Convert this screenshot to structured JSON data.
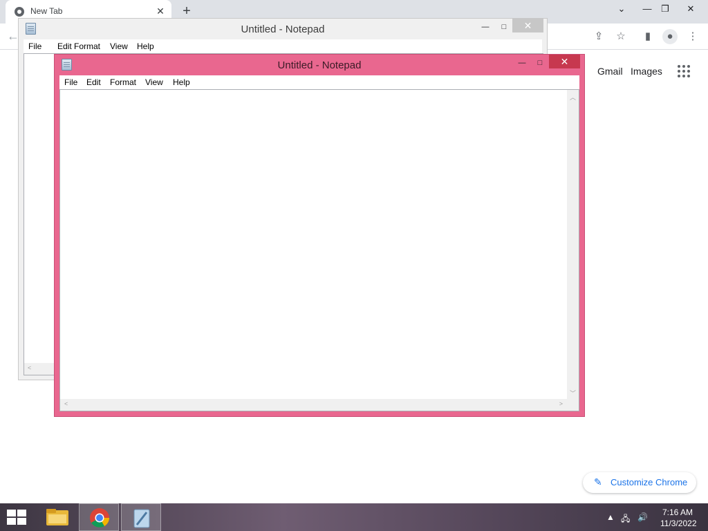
{
  "browser": {
    "tab_title": "New Tab",
    "tab_close": "✕",
    "new_tab": "+",
    "window_buttons": {
      "dropdown": "⌄",
      "minimize": "—",
      "restore": "❐",
      "close": "✕"
    },
    "toolbar_icons": {
      "share": "⇪",
      "bookmark": "☆",
      "side_panel": "▮",
      "profile": "●",
      "menu": "⋮"
    },
    "back": "←",
    "ntp": {
      "gmail": "Gmail",
      "images": "Images",
      "customize": "Customize Chrome",
      "customize_icon": "✎"
    }
  },
  "notepad_back": {
    "title": "Untitled - Notepad",
    "menu": [
      "File",
      "Edit",
      "Format",
      "View",
      "Help"
    ],
    "buttons": {
      "minimize": "—",
      "maximize": "□",
      "close": "✕"
    }
  },
  "notepad_front": {
    "title": "Untitled - Notepad",
    "menu": [
      "File",
      "Edit",
      "Format",
      "View",
      "Help"
    ],
    "buttons": {
      "minimize": "—",
      "maximize": "□",
      "close": "✕"
    },
    "content": ""
  },
  "taskbar": {
    "time": "7:16 AM",
    "date": "11/3/2022",
    "tray": {
      "chevron": "▲",
      "network": "🖧",
      "volume": "🔊"
    },
    "apps": [
      "File Explorer",
      "Google Chrome",
      "Notepad"
    ]
  },
  "colors": {
    "active_frame": "#e9678f",
    "close_red": "#c7384f",
    "taskbar": "#5a4a5e",
    "link_blue": "#1a73e8"
  }
}
